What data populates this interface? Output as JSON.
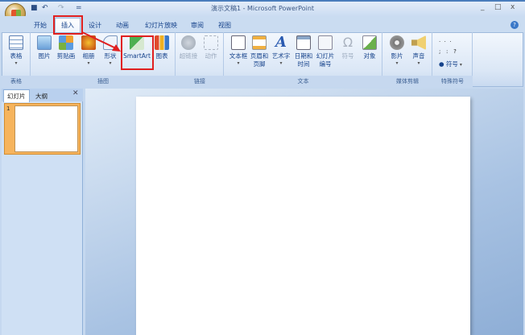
{
  "window": {
    "title": "演示文稿1 - Microsoft PowerPoint",
    "minimize": "_",
    "maximize": "□",
    "close": "x",
    "help": "?"
  },
  "quick_access": {
    "save": "■",
    "undo": "↶",
    "redo": "↷",
    "customize": "="
  },
  "tabs": [
    "开始",
    "插入",
    "设计",
    "动画",
    "幻灯片放映",
    "审阅",
    "视图"
  ],
  "ribbon": {
    "groups": [
      "表格",
      "插图",
      "链接",
      "文本",
      "媒体剪辑",
      "特殊符号"
    ],
    "buttons": {
      "table": "表格",
      "picture": "图片",
      "clipart": "剪贴画",
      "album": "相册",
      "shapes": "形状",
      "smartart": "SmartArt",
      "chart": "图表",
      "hyperlink": "超链接",
      "action": "动作",
      "textbox": "文本框",
      "header_footer": "页眉和页脚",
      "wordart": "艺术字",
      "datetime": "日期和时间",
      "slide_number": "幻灯片编号",
      "symbol": "符号",
      "object": "对象",
      "movie": "影片",
      "sound": "声音",
      "special_symbol": "符号"
    },
    "special_marks": "·  ·  ·\n;   :   ?"
  },
  "left_pane": {
    "tabs": [
      "幻灯片",
      "大纲"
    ],
    "close": "✕",
    "slide_number": "1"
  },
  "colors": {
    "highlight": "#e02020",
    "accent": "#f6b45d"
  }
}
